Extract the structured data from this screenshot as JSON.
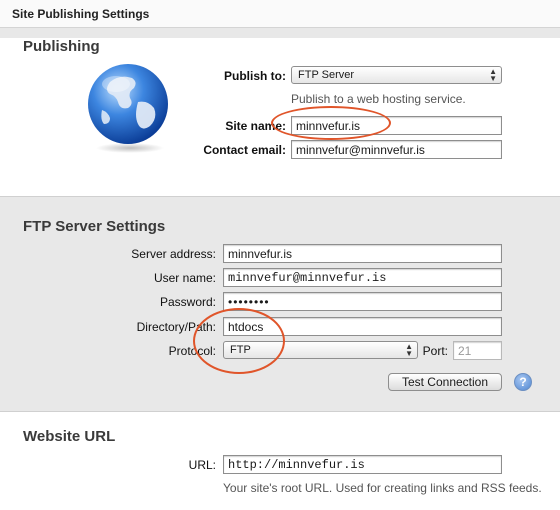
{
  "window": {
    "title": "Site Publishing Settings"
  },
  "publishing": {
    "heading": "Publishing",
    "publish_to_label": "Publish to:",
    "publish_to_value": "FTP Server",
    "publish_to_help": "Publish to a web hosting service.",
    "site_name_label": "Site name:",
    "site_name_value": "minnvefur.is",
    "contact_email_label": "Contact email:",
    "contact_email_value": "minnvefur@minnvefur.is"
  },
  "ftp": {
    "heading": "FTP Server Settings",
    "server_address_label": "Server address:",
    "server_address_value": "minnvefur.is",
    "user_name_label": "User name:",
    "user_name_value": "minnvefur@minnvefur.is",
    "password_label": "Password:",
    "password_value": "••••••••",
    "directory_label": "Directory/Path:",
    "directory_value": "htdocs",
    "protocol_label": "Protocol:",
    "protocol_value": "FTP",
    "port_label": "Port:",
    "port_value": "21",
    "test_button": "Test Connection",
    "help_button": "?"
  },
  "website_url": {
    "heading": "Website URL",
    "url_label": "URL:",
    "url_value": "http://minnvefur.is",
    "url_help": "Your site's root URL. Used for creating links and RSS feeds."
  },
  "colors": {
    "annotation": "#e0552a",
    "band": "#e8e8e8"
  }
}
